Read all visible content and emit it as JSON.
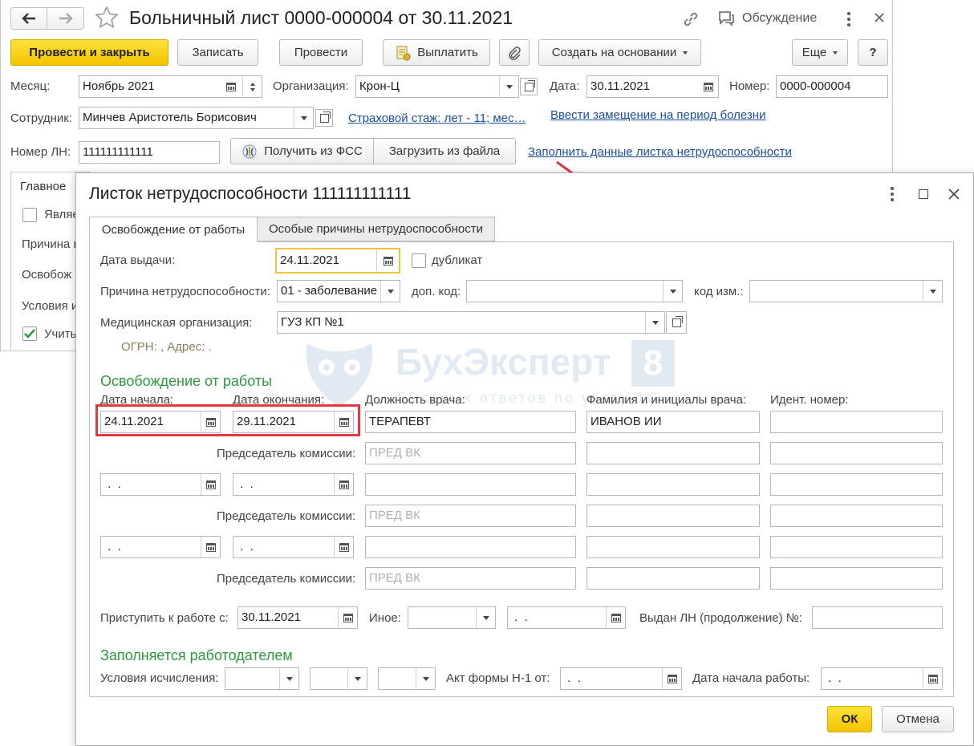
{
  "main": {
    "title": "Больничный лист 0000-000004 от 30.11.2021",
    "discussion": "Обсуждение",
    "toolbar": {
      "post_close": "Провести и закрыть",
      "save": "Записать",
      "post": "Провести",
      "pay": "Выплатить",
      "create_based": "Создать на основании",
      "more": "Еще",
      "help": "?"
    },
    "month_label": "Месяц:",
    "month_value": "Ноябрь 2021",
    "org_label": "Организация:",
    "org_value": "Крон-Ц",
    "date_label": "Дата:",
    "date_value": "30.11.2021",
    "number_label": "Номер:",
    "number_value": "0000-000004",
    "employee_label": "Сотрудник:",
    "employee_value": "Минчев Аристотель Борисович",
    "insurance_link": "Страховой стаж: лет - 11; мес…",
    "substitute_link": "Ввести замещение на период болезни",
    "ln_label": "Номер ЛН:",
    "ln_value": "111111111111",
    "fss_button": "Получить из ФСС",
    "load_file_button": "Загрузить из файла",
    "fill_link": "Заполнить данные листка нетрудоспособности",
    "tab_main": "Главное",
    "left_cut": [
      "Являе",
      "Причина н",
      "Освобож",
      "Условия и",
      "Учиты"
    ]
  },
  "dialog": {
    "title": "Листок нетрудоспособности 111111111111",
    "tabs": [
      "Освобождение от работы",
      "Особые причины нетрудоспособности"
    ],
    "issue_date_label": "Дата выдачи:",
    "issue_date": "24.11.2021",
    "duplicate_label": "дубликат",
    "reason_label": "Причина нетрудоспособности:",
    "reason_value": "01 - заболевание",
    "add_code_label": "доп. код:",
    "change_code_label": "код изм.:",
    "med_org_label": "Медицинская организация:",
    "med_org_value": "ГУЗ КП №1",
    "ogrn_text": "ОГРН: , Адрес: .",
    "release_header": "Освобождение от работы",
    "col_start": "Дата начала:",
    "col_end": "Дата окончания:",
    "col_position": "Должность врача:",
    "col_doctor": "Фамилия и инициалы врача:",
    "col_id": "Идент.  номер:",
    "row1": {
      "start": "24.11.2021",
      "end": "29.11.2021",
      "position": "ТЕРАПЕВТ",
      "doctor": "ИВАНОВ ИИ"
    },
    "empty_date": " .  .",
    "chairman_label": "Председатель комиссии:",
    "chairman_placeholder": "ПРЕД ВК",
    "return_label": "Приступить к работе с:",
    "return_value": "30.11.2021",
    "other_label": "Иное:",
    "issued_cont_label": "Выдан ЛН (продолжение) №:",
    "employer_header": "Заполняется работодателем",
    "calc_cond_label": "Условия исчисления:",
    "act_label": "Акт формы Н-1 от:",
    "work_start_label": "Дата начала работы:",
    "ok": "ОК",
    "cancel": "Отмена"
  },
  "watermark": {
    "brand": "БухЭксперт",
    "digit": "8",
    "tagline": "Быстрых ответов по учету 1С"
  },
  "colors": {
    "accent_yellow": "#f4c400",
    "green_header": "#2b9a3f",
    "link_blue": "#1c4fa0",
    "highlight_red": "#e0393e"
  }
}
